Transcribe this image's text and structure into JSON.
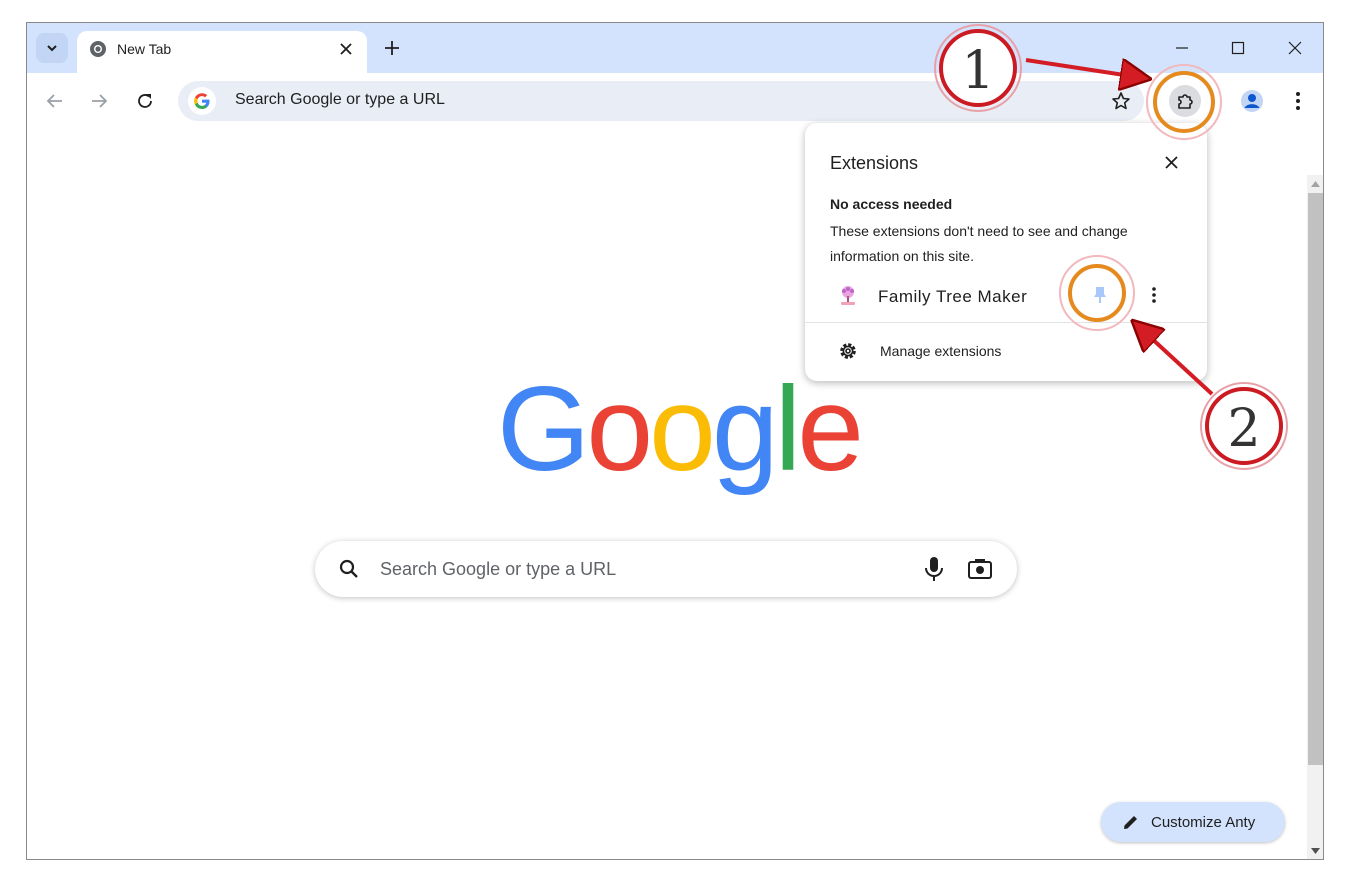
{
  "tab": {
    "title": "New Tab"
  },
  "omnibox": {
    "placeholder": "Search Google or type a URL"
  },
  "logo": {
    "letters": [
      "G",
      "o",
      "o",
      "g",
      "l",
      "e"
    ]
  },
  "search": {
    "placeholder": "Search Google or type a URL"
  },
  "extensions_popup": {
    "title": "Extensions",
    "section_title": "No access needed",
    "section_desc": "These extensions don't need to see and change information on this site.",
    "extension_name": "Family Tree Maker",
    "manage_label": "Manage extensions"
  },
  "customize": {
    "label": "Customize Anty"
  },
  "annotations": {
    "step1": "1",
    "step2": "2",
    "highlight_color": "#e58a1f",
    "arrow_color": "#d41c24"
  },
  "colors": {
    "tabstrip": "#d3e3fd",
    "omnibox": "#e9eef6",
    "google_blue": "#4285f4",
    "google_red": "#ea4335",
    "google_yellow": "#fbbc05",
    "google_green": "#34a853"
  },
  "icons": [
    "tab-search-icon",
    "chrome-icon",
    "close-icon",
    "plus-icon",
    "minimize-icon",
    "maximize-icon",
    "back-arrow-icon",
    "forward-arrow-icon",
    "reload-icon",
    "google-g-icon",
    "star-icon",
    "puzzle-icon",
    "profile-icon",
    "kebab-menu-icon",
    "search-icon",
    "mic-icon",
    "camera-icon",
    "pencil-icon",
    "pin-icon",
    "gear-icon",
    "family-tree-icon"
  ]
}
